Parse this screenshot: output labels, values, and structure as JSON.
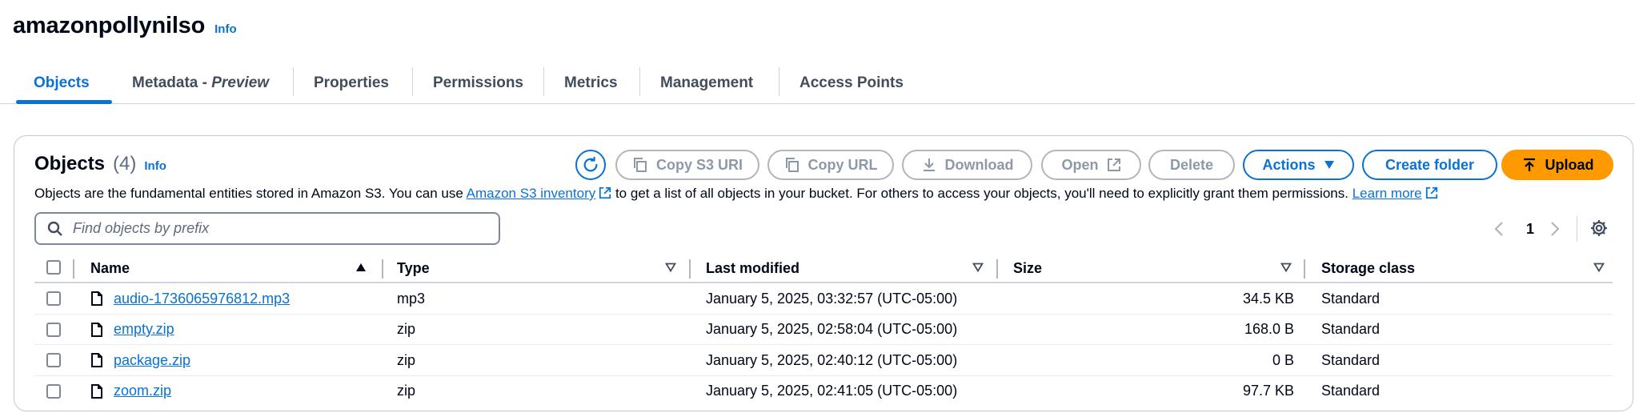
{
  "bucket": {
    "name": "amazonpollynilso",
    "info": "Info"
  },
  "tabs": [
    {
      "label": "Objects",
      "active": true
    },
    {
      "label": "Metadata - ",
      "label_italic": "Preview"
    },
    {
      "label": "Properties"
    },
    {
      "label": "Permissions"
    },
    {
      "label": "Metrics"
    },
    {
      "label": "Management"
    },
    {
      "label": "Access Points"
    }
  ],
  "objects_panel": {
    "title": "Objects",
    "count": "(4)",
    "info": "Info",
    "toolbar": {
      "copy_s3_uri": "Copy S3 URI",
      "copy_url": "Copy URL",
      "download": "Download",
      "open": "Open",
      "delete": "Delete",
      "actions": "Actions",
      "create_folder": "Create folder",
      "upload": "Upload"
    },
    "description": {
      "text1": "Objects are the fundamental entities stored in Amazon S3. You can use ",
      "link1": "Amazon S3 inventory",
      "text2": " to get a list of all objects in your bucket. For others to access your objects, you'll need to explicitly grant them permissions. ",
      "link2": "Learn more"
    },
    "search": {
      "placeholder": "Find objects by prefix",
      "value": ""
    },
    "pagination": {
      "current_page": "1"
    },
    "columns": [
      "Name",
      "Type",
      "Last modified",
      "Size",
      "Storage class"
    ],
    "rows": [
      {
        "name": "audio-1736065976812.mp3",
        "type": "mp3",
        "last_modified": "January 5, 2025, 03:32:57 (UTC-05:00)",
        "size": "34.5 KB",
        "storage_class": "Standard"
      },
      {
        "name": "empty.zip",
        "type": "zip",
        "last_modified": "January 5, 2025, 02:58:04 (UTC-05:00)",
        "size": "168.0 B",
        "storage_class": "Standard"
      },
      {
        "name": "package.zip",
        "type": "zip",
        "last_modified": "January 5, 2025, 02:40:12 (UTC-05:00)",
        "size": "0 B",
        "storage_class": "Standard"
      },
      {
        "name": "zoom.zip",
        "type": "zip",
        "last_modified": "January 5, 2025, 02:41:05 (UTC-05:00)",
        "size": "97.7 KB",
        "storage_class": "Standard"
      }
    ]
  },
  "colors": {
    "link": "#0972d3",
    "upload": "#ff9900",
    "text": "#000716",
    "disabled": "#8d99a8"
  }
}
